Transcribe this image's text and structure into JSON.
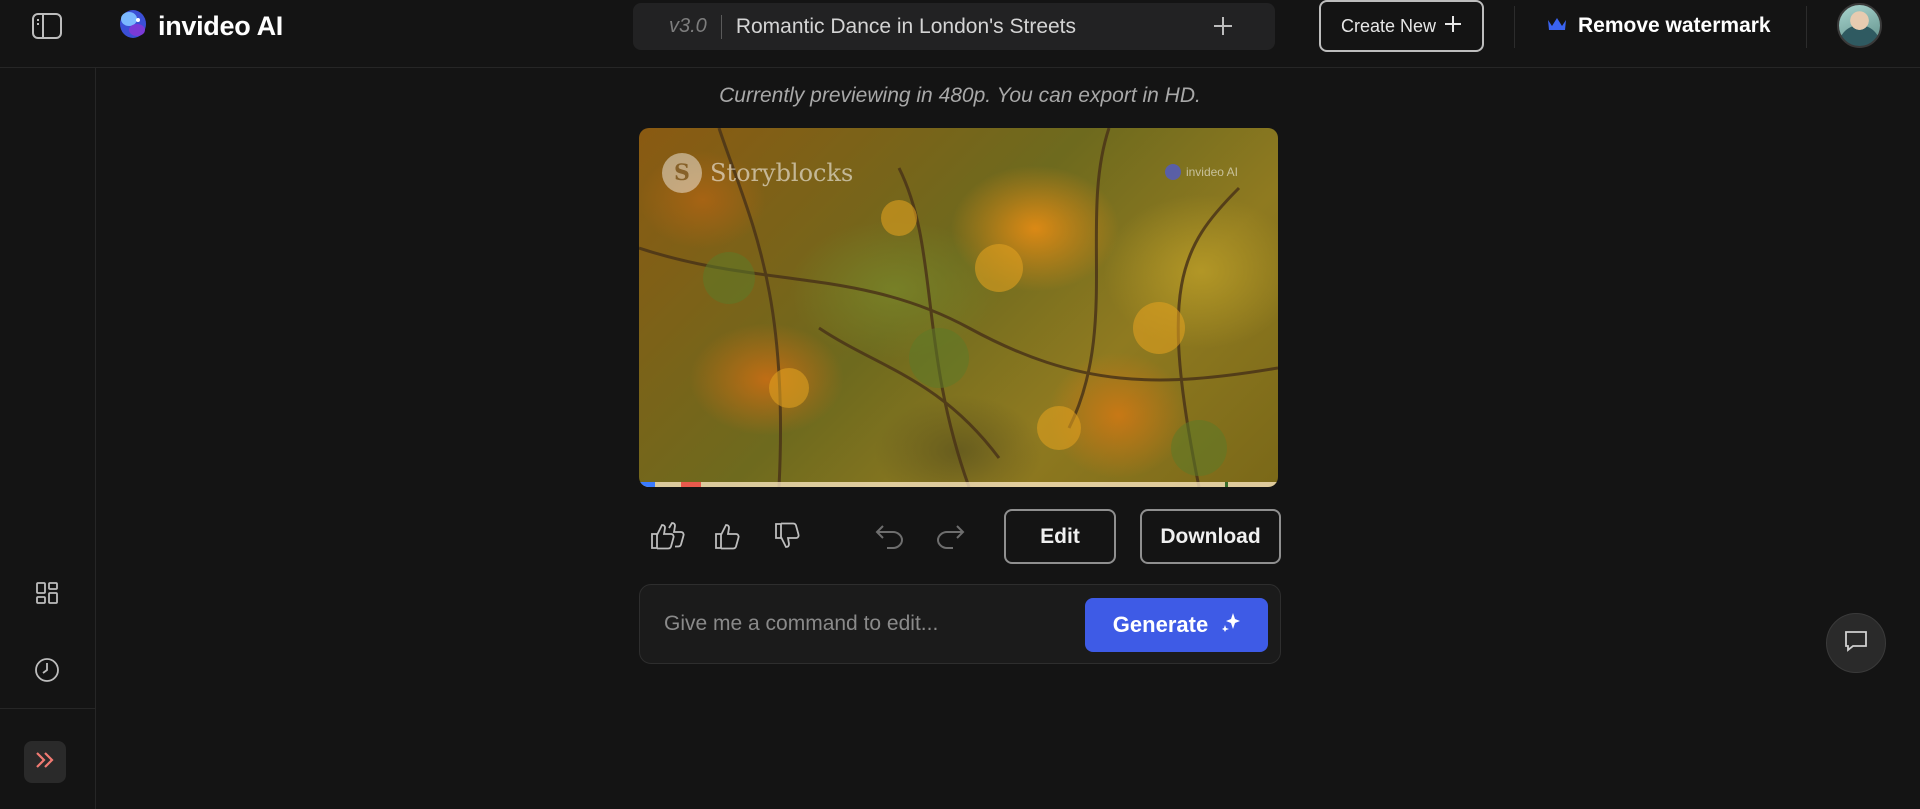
{
  "app": {
    "brand_name": "invideo AI"
  },
  "project": {
    "version": "v3.0",
    "title": "Romantic Dance in London's Streets"
  },
  "header": {
    "create_new_label": "Create New",
    "remove_watermark_label": "Remove watermark"
  },
  "preview": {
    "note": "Currently previewing in 480p. You can export in HD.",
    "watermark_storyblocks": "Storyblocks",
    "watermark_invideo": "invideo AI",
    "progress_played_fraction": 0.025
  },
  "actions": {
    "edit_label": "Edit",
    "download_label": "Download"
  },
  "command": {
    "placeholder": "Give me a command to edit...",
    "value": "",
    "generate_label": "Generate"
  },
  "icons": {
    "sidebar_toggle": "sidebar-toggle-icon",
    "brand_logo": "invideo-logo-icon",
    "add": "plus-icon",
    "crown": "crown-icon",
    "grid": "grid-icon",
    "history": "clock-icon",
    "expand": "chevrons-right-icon",
    "like_double": "double-thumbs-up-icon",
    "like": "thumbs-up-icon",
    "dislike": "thumbs-down-icon",
    "undo": "undo-icon",
    "redo": "redo-icon",
    "sparkle": "sparkle-icon",
    "chat": "chat-icon"
  },
  "colors": {
    "background": "#141414",
    "accent": "#3e5be6",
    "crown": "#3a63f0",
    "expand_chevrons": "#f07a72"
  }
}
